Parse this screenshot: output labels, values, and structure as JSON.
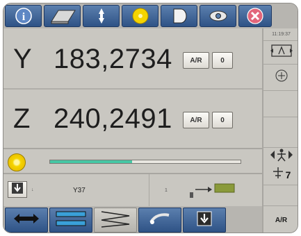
{
  "toolbar": {
    "icons": [
      "info-icon",
      "workpiece-icon",
      "arrows-icon",
      "light-icon",
      "record-icon",
      "eye-icon",
      "close-icon"
    ]
  },
  "axes": [
    {
      "letter": "Y",
      "value": "183,2734",
      "ar_label": "A/R",
      "zero_label": "0"
    },
    {
      "letter": "Z",
      "value": "240,2491",
      "ar_label": "A/R",
      "zero_label": "0"
    }
  ],
  "right": {
    "clock": "11:19:37",
    "seven": "7",
    "ar_label": "A/R"
  },
  "progress": {
    "fraction": 0.43
  },
  "status": {
    "text": "Y37",
    "small_left": "↓",
    "small_mid": "1"
  },
  "bottom": {
    "icons": [
      "double-arrow-icon",
      "bars-icon",
      "zigzag-icon",
      "probe-icon",
      "download-icon"
    ]
  },
  "colors": {
    "toolbar_blue": "#2f5386",
    "panel": "#c9c7c1",
    "progress": "#46c7a4",
    "accent_yellow": "#f5d400"
  }
}
